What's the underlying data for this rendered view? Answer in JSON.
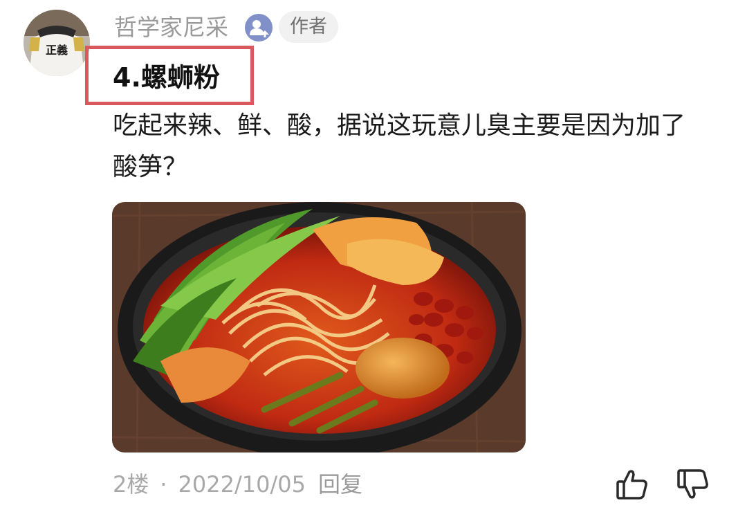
{
  "comment": {
    "author": {
      "name": "哲学家尼采",
      "tag": "作者",
      "avatar_text": "正義"
    },
    "title": "4.螺蛳粉",
    "body": "吃起来辣、鲜、酸，据说这玩意儿臭主要是因为加了酸笋？",
    "image": {
      "subject": "螺蛳粉",
      "icon": "food-photo"
    },
    "floor": "2楼",
    "separator": "·",
    "date": "2022/10/05",
    "reply_label": "回复",
    "actions": {
      "like_icon": "thumbs-up-icon",
      "dislike_icon": "thumbs-down-icon"
    }
  },
  "colors": {
    "highlight_border": "#d9595d",
    "badge": "#8190c8",
    "meta_text": "#a8a8a8"
  }
}
